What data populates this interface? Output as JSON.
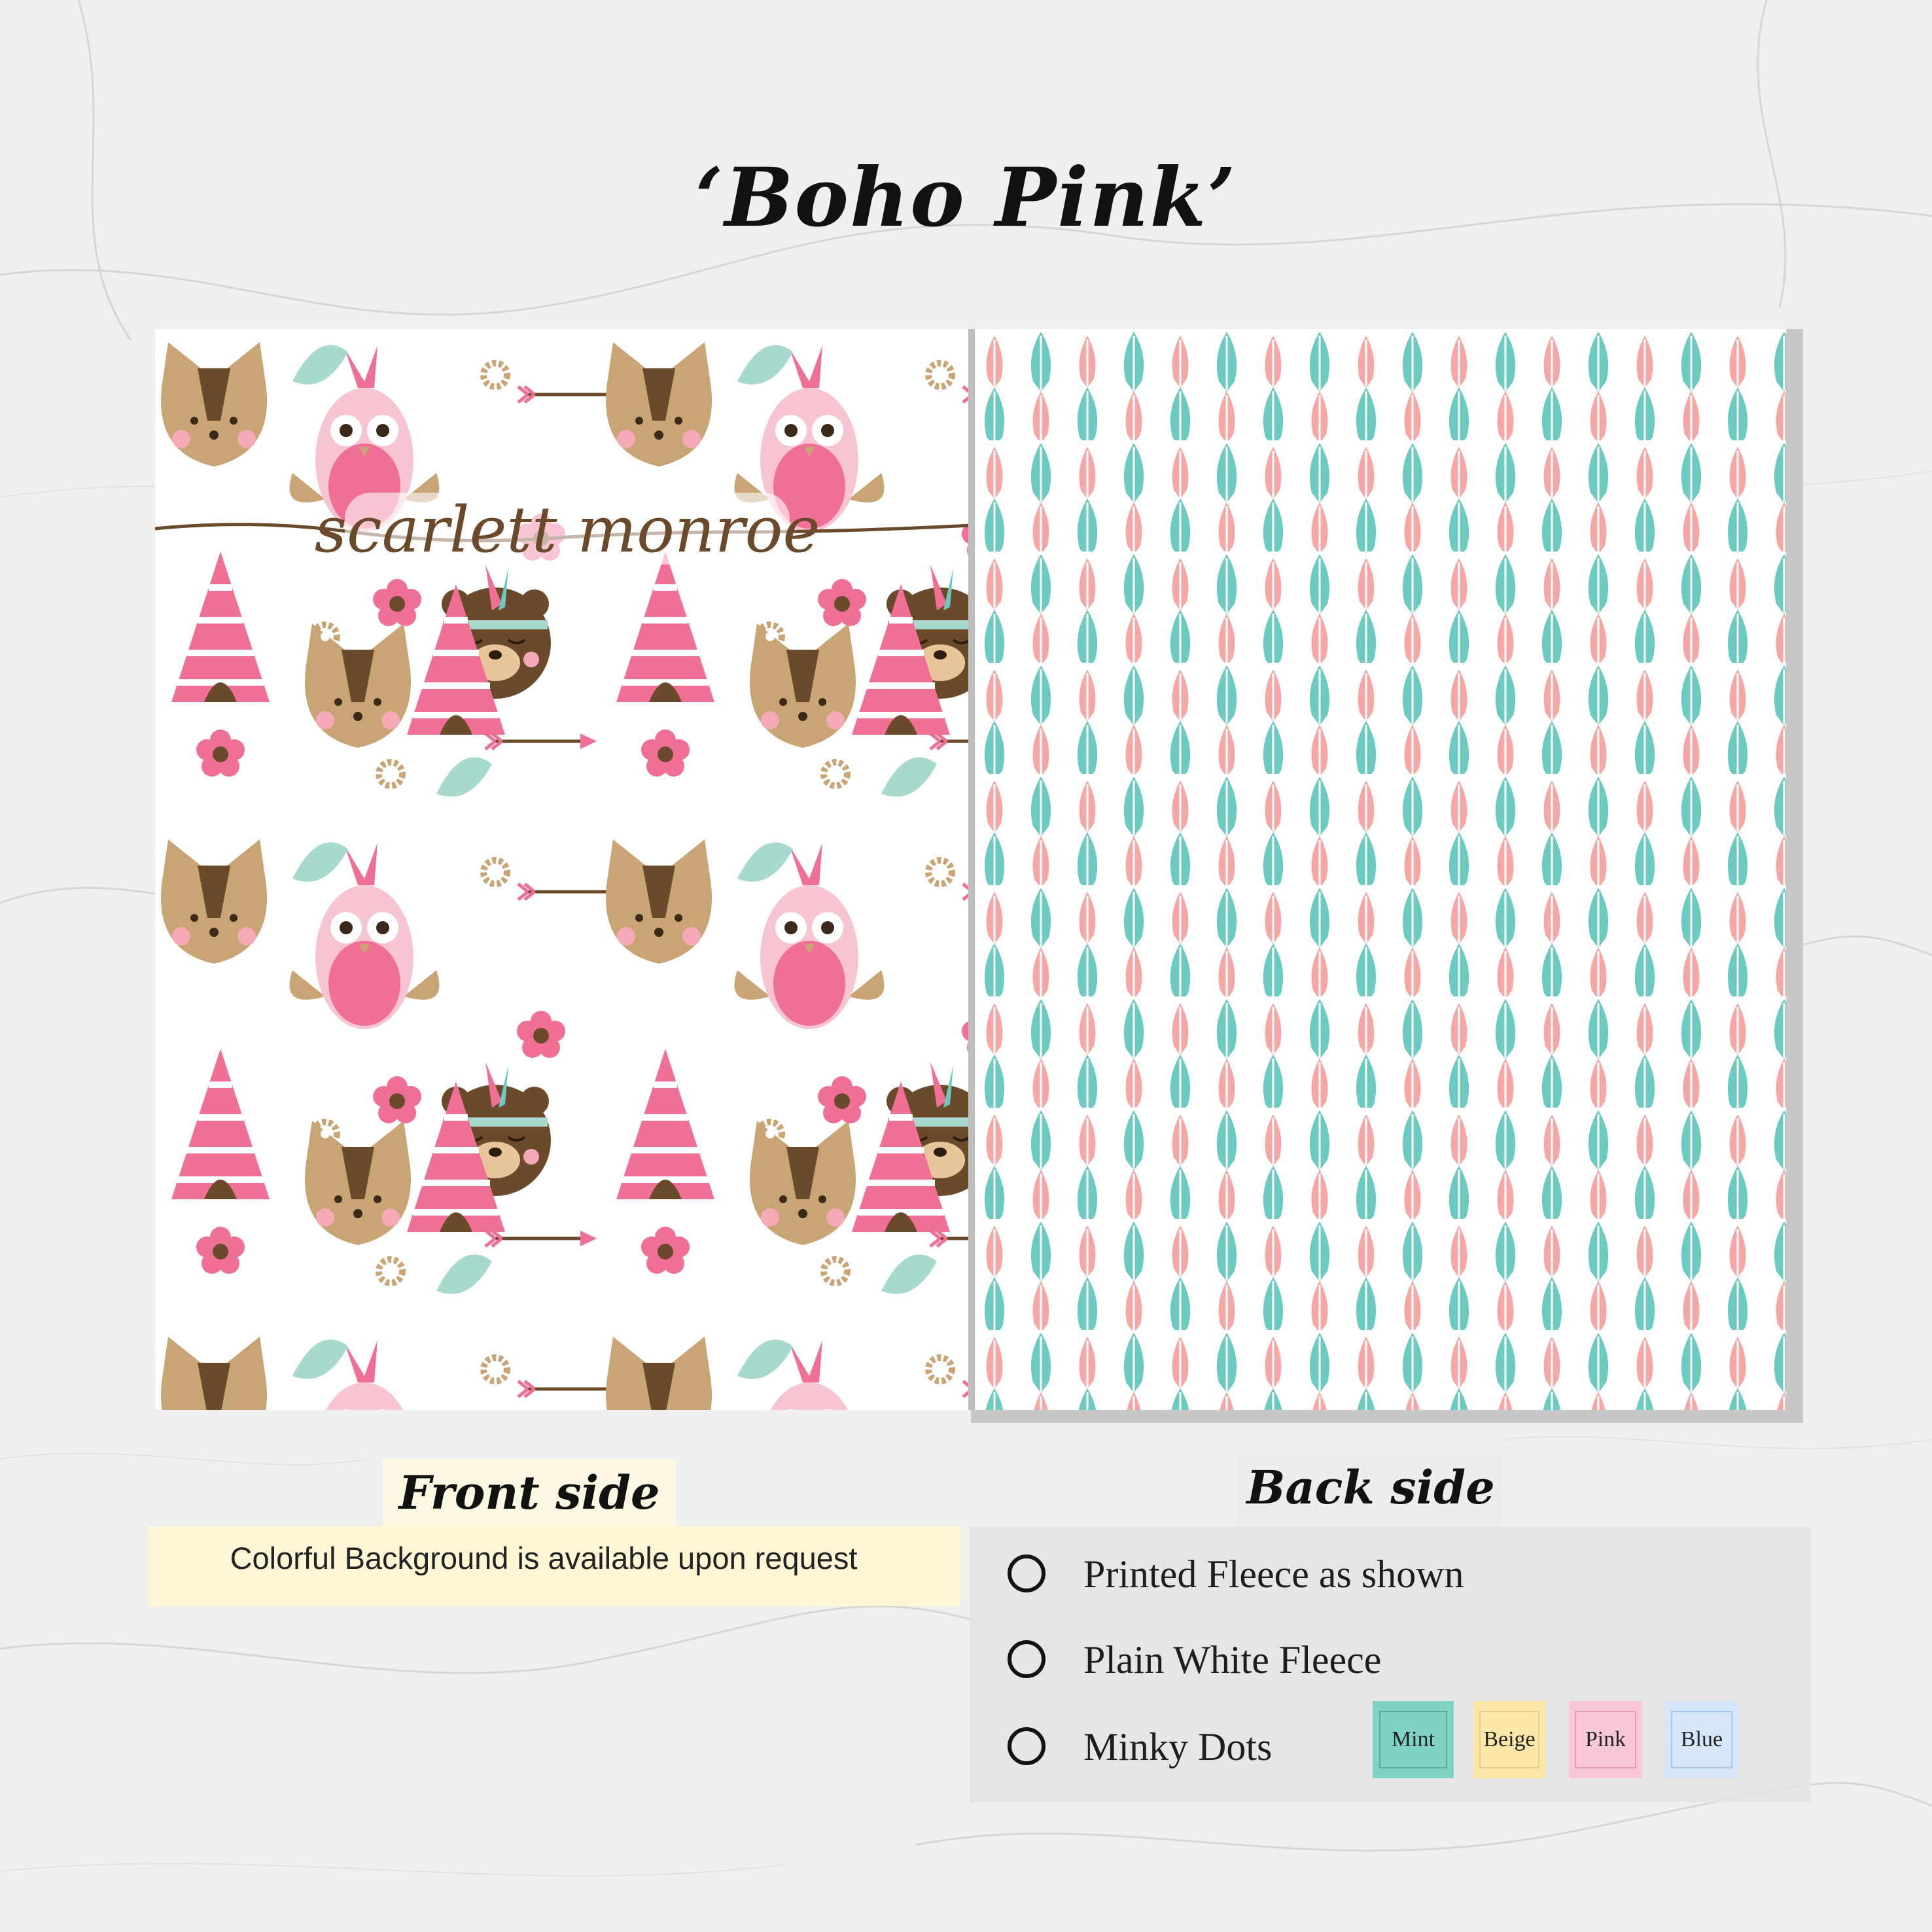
{
  "title": "‘Boho Pink’",
  "front": {
    "label": "Front side",
    "note": "Colorful Background is available upon request",
    "design_text": "scarlett monroe"
  },
  "back": {
    "label": "Back side",
    "options": [
      {
        "label": "Printed Fleece as shown"
      },
      {
        "label": "Plain White Fleece"
      },
      {
        "label": "Minky Dots"
      }
    ],
    "swatches": [
      {
        "label": "Mint",
        "fill": "#7ed3c2",
        "border": "#5aa99a"
      },
      {
        "label": "Beige",
        "fill": "#fbe7a6",
        "border": "#e6cf86"
      },
      {
        "label": "Pink",
        "fill": "#f8c8d6",
        "border": "#e79ab2"
      },
      {
        "label": "Blue",
        "fill": "#d5e6f8",
        "border": "#a9c6e8"
      }
    ]
  },
  "colors": {
    "pink": "#ef6f95",
    "light_pink": "#f7c5d1",
    "brown": "#6b4a2b",
    "tan": "#c9a474",
    "mint": "#6ccac0",
    "peach": "#f5a7a5"
  }
}
